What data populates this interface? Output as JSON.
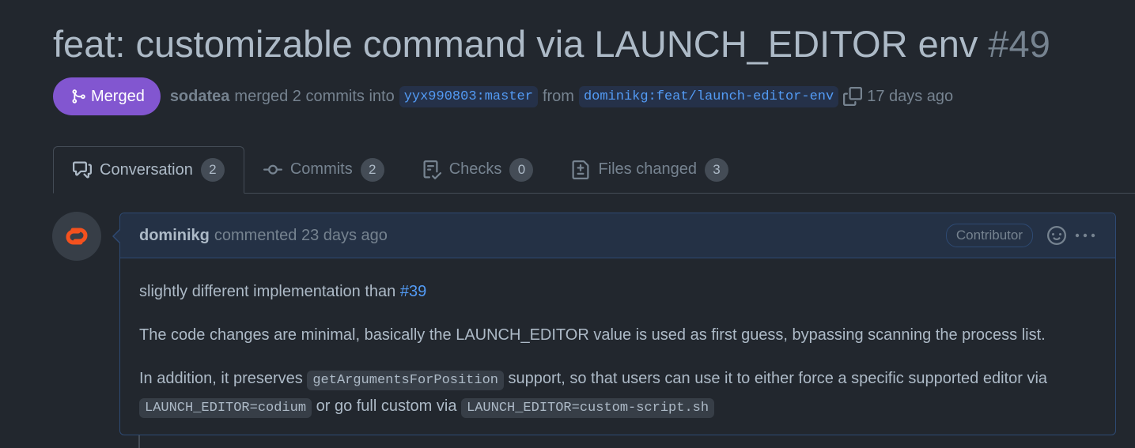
{
  "pr": {
    "title": "feat: customizable command via LAUNCH_EDITOR env",
    "number": "#49",
    "state": "Merged",
    "merged_by": "sodatea",
    "merge_text": "merged 2 commits into",
    "base_branch": "yyx990803:master",
    "from_text": "from",
    "head_branch": "dominikg:feat/launch-editor-env",
    "time": "17 days ago",
    "state_color": "#8256d0"
  },
  "tabs": [
    {
      "label": "Conversation",
      "count": "2",
      "icon": "comment-discussion-icon"
    },
    {
      "label": "Commits",
      "count": "2",
      "icon": "git-commit-icon"
    },
    {
      "label": "Checks",
      "count": "0",
      "icon": "checklist-icon"
    },
    {
      "label": "Files changed",
      "count": "3",
      "icon": "file-diff-icon"
    }
  ],
  "comment": {
    "author": "dominikg",
    "action": "commented 23 days ago",
    "role": "Contributor",
    "body": {
      "p1_text": "slightly different implementation than ",
      "p1_link": "#39",
      "p2": "The code changes are minimal, basically the LAUNCH_EDITOR value is used as first guess, bypassing scanning the process list.",
      "p3_a": "In addition, it preserves ",
      "p3_code1": "getArgumentsForPosition",
      "p3_b": " support, so that users can use it to either force a specific supported editor via ",
      "p3_code2": "LAUNCH_EDITOR=codium",
      "p3_c": " or go full custom via ",
      "p3_code3": "LAUNCH_EDITOR=custom-script.sh"
    }
  },
  "colors": {
    "background": "#22272e",
    "link": "#539bf5",
    "avatar_accent": "#f4511e"
  }
}
